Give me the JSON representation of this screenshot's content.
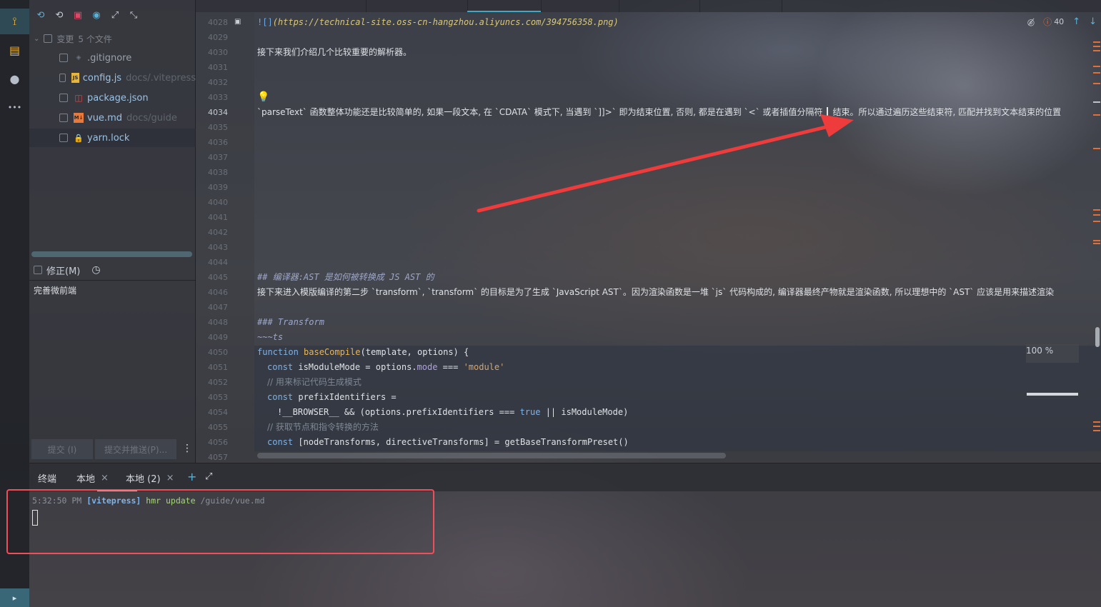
{
  "activity_bar": {
    "items": [
      {
        "name": "source-control-icon",
        "glyph": "⟟"
      },
      {
        "name": "database-icon",
        "glyph": "▤"
      },
      {
        "name": "github-icon",
        "glyph": "●"
      },
      {
        "name": "more-icon",
        "glyph": "•••"
      }
    ],
    "terminal_glyph": "▸"
  },
  "scm": {
    "toolbar": [
      "⟲",
      "⟲",
      "▣",
      "◉",
      "⤢",
      "⤡"
    ],
    "changes_label": "变更",
    "changes_count": "5 个文件",
    "files": [
      {
        "name": ".gitignore",
        "path": "",
        "icon": "◈",
        "icon_color": "#6b7380"
      },
      {
        "name": "config.js",
        "path": "docs/.vitepress",
        "icon": "JS",
        "icon_color": "#e8b53b"
      },
      {
        "name": "package.json",
        "path": "",
        "icon": "◫",
        "icon_color": "#e04848"
      },
      {
        "name": "vue.md",
        "path": "docs/guide",
        "icon": "M↓",
        "icon_color": "#e67a3d"
      },
      {
        "name": "yarn.lock",
        "path": "",
        "icon": "🔒",
        "icon_color": "#e04848"
      }
    ],
    "amend_label": "修正(M)",
    "amend_glyph": "◷",
    "commit_message": "完善微前端",
    "commit_button": "提交 (I)",
    "commit_push_button": "提交并推送(P)...",
    "more_glyph": "⋮"
  },
  "editor": {
    "line_numbers": [
      "4028",
      "4029",
      "4030",
      "4031",
      "4032",
      "4033",
      "4034",
      "4035",
      "4036",
      "4037",
      "4038",
      "4039",
      "4040",
      "4041",
      "4042",
      "4043",
      "4044",
      "4045",
      "4046",
      "4047",
      "4048",
      "4049",
      "4050",
      "4051",
      "4052",
      "4053",
      "4054",
      "4055",
      "4056",
      "4057"
    ],
    "current_line": "4034",
    "gutter_glyph": "▣",
    "lightbulb": "💡",
    "image_link_prefix": "![]",
    "image_link_url": "(https://technical-site.oss-cn-hangzhou.aliyuncs.com/394756358.png)",
    "line_4030": "接下来我们介绍几个比较重要的解析器。",
    "line_4034_a": "`parseText` 函数整体功能还是比较简单的, 如果一段文本, 在 `CDATA` 模式下, 当遇到 `]]>` 即为结束位置, 否则, 都是在遇到 `<` 或者插值分隔符",
    "line_4034_b": "结束。所以通过遍历这些结束符, 匹配并找到文本结束的位置",
    "line_4045": "## 编译器:AST 是如何被转换成 JS AST 的",
    "line_4046": "接下来进入模版编译的第二步 `transform`, `transform` 的目标是为了生成 `JavaScript AST`。因为渲染函数是一堆 `js` 代码构成的, 编译器最终产物就是渲染函数, 所以理想中的 `AST` 应该是用来描述渲染",
    "line_4048": "### Transform",
    "line_4049": "~~~ts",
    "code": {
      "l4050": {
        "kw": "function",
        "fn": "baseCompile",
        "rest": "(template, options) {"
      },
      "l4051": {
        "kw": "const",
        "a": "isModuleMode = options.",
        "prop": "mode",
        "op": " === ",
        "str": "'module'"
      },
      "l4052": "// 用来标记代码生成模式",
      "l4053": {
        "kw": "const",
        "a": "prefixIdentifiers ="
      },
      "l4054": {
        "a": "!__BROWSER__ && (options.prefixIdentifiers === ",
        "bool": "true",
        "b": " || isModuleMode)"
      },
      "l4055": "// 获取节点和指令转换的方法",
      "l4056": {
        "kw": "const",
        "a": "[nodeTransforms, directiveTransforms] = getBaseTransformPreset()"
      }
    },
    "status": {
      "eye_glyph": "◎̸",
      "problems_glyph": "ⓘ",
      "problems_count": "40",
      "up": "↑",
      "down": "↓"
    },
    "zoom": "100 %",
    "colors": {
      "keyword": "#7fb2e6",
      "function": "#e6b65c",
      "string": "#d5a56b",
      "comment": "#7f8794",
      "heading": "#9da7c9",
      "inline_code": "#8d939d",
      "link": "#6aa8e8",
      "url": "#d9c77a",
      "warn_mark": "#e0703a",
      "annotation": "#ee3b3b"
    }
  },
  "terminal": {
    "title": "终端",
    "tabs": [
      "本地",
      "本地 (2)"
    ],
    "close_glyph": "×",
    "add_glyph": "+",
    "expand_glyph": "⤢",
    "time": "5:32:50 PM",
    "tag": "[vitepress]",
    "event": "hmr update",
    "path": "/guide/vue.md"
  }
}
